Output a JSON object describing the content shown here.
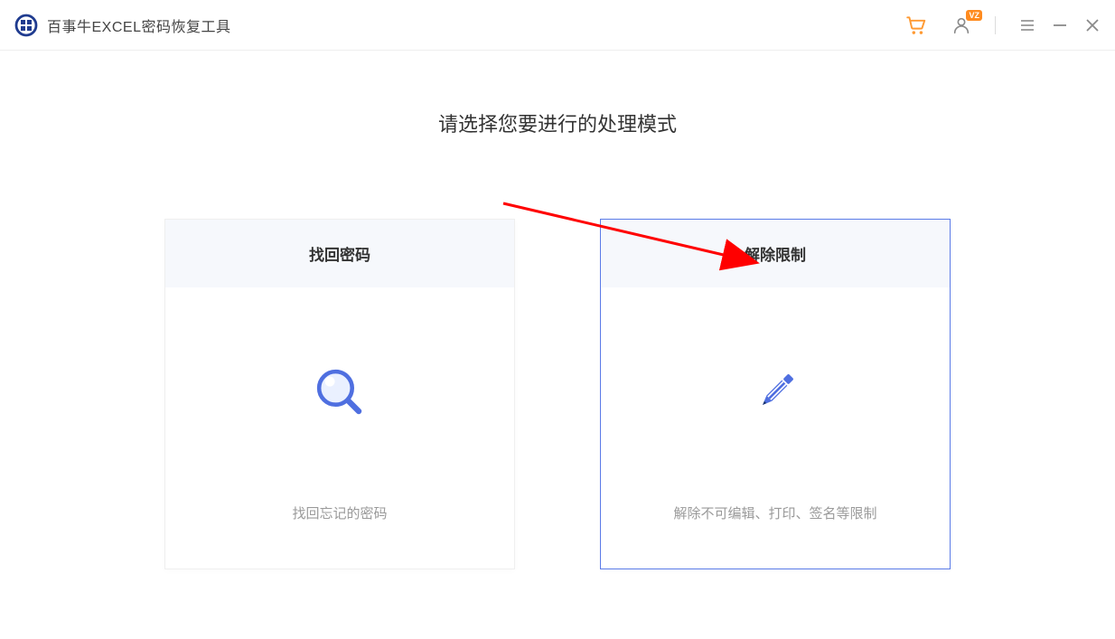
{
  "app": {
    "title": "百事牛EXCEL密码恢复工具"
  },
  "titlebar": {
    "cart_icon": "cart-icon",
    "user_icon": "user-icon",
    "user_badge": "VZ",
    "menu_icon": "menu-icon",
    "minimize_icon": "minimize-icon",
    "close_icon": "close-icon"
  },
  "main": {
    "heading": "请选择您要进行的处理模式"
  },
  "cards": [
    {
      "title": "找回密码",
      "description": "找回忘记的密码",
      "icon": "magnifier-icon",
      "selected": false
    },
    {
      "title": "解除限制",
      "description": "解除不可编辑、打印、签名等限制",
      "icon": "pencil-icon",
      "selected": true
    }
  ],
  "colors": {
    "accent_blue": "#4f6fe0",
    "accent_orange": "#ff8b1f",
    "logo_blue": "#1f3b8f"
  }
}
